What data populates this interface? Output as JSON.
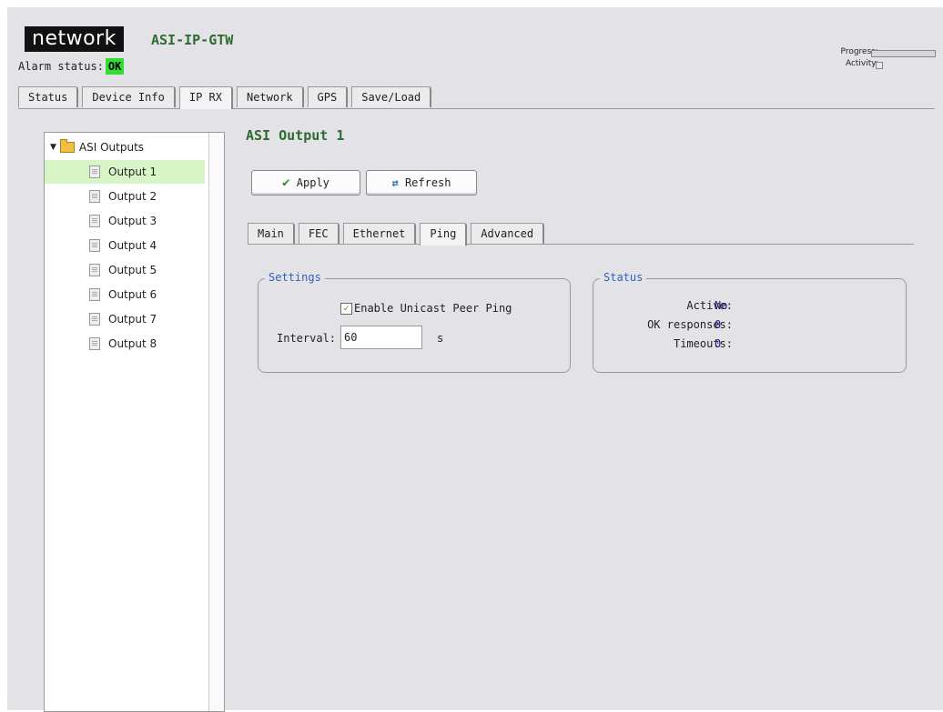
{
  "header": {
    "logo": "network",
    "product": "ASI-IP-GTW",
    "alarm_label": "Alarm status:",
    "alarm_value": "OK",
    "progress_label": "Progress:",
    "activity_label": "Activity:"
  },
  "main_tabs": [
    "Status",
    "Device Info",
    "IP RX",
    "Network",
    "GPS",
    "Save/Load"
  ],
  "main_tab_active": "IP RX",
  "tree": {
    "root": "ASI Outputs",
    "items": [
      "Output 1",
      "Output 2",
      "Output 3",
      "Output 4",
      "Output 5",
      "Output 6",
      "Output 7",
      "Output 8"
    ],
    "selected": "Output 1"
  },
  "content": {
    "title": "ASI Output 1",
    "apply_label": "Apply",
    "refresh_label": "Refresh"
  },
  "sub_tabs": [
    "Main",
    "FEC",
    "Ethernet",
    "Ping",
    "Advanced"
  ],
  "sub_tab_active": "Ping",
  "settings": {
    "legend": "Settings",
    "enable_label": "Enable Unicast Peer Ping",
    "enable_checked": true,
    "interval_label": "Interval:",
    "interval_value": "60",
    "interval_unit": "s"
  },
  "status": {
    "legend": "Status",
    "active_label": "Active:",
    "active_value": "No",
    "ok_label": "OK responses:",
    "ok_value": "0",
    "timeouts_label": "Timeouts:",
    "timeouts_value": "0"
  },
  "colors": {
    "accent_green": "#2e6b2e",
    "alarm_ok": "#33dd33",
    "legend_blue": "#2e62b8",
    "selected_row": "#d8f5c8"
  }
}
